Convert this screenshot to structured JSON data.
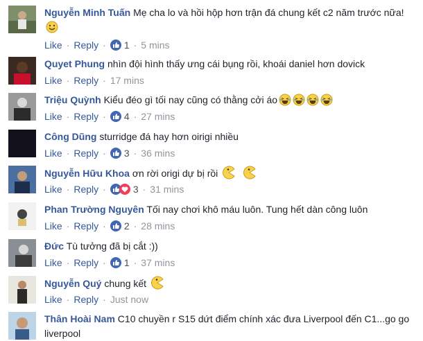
{
  "ui": {
    "like_label": "Like",
    "reply_label": "Reply",
    "separator": "·",
    "colors": {
      "name": "#365899",
      "meta": "#90949c",
      "like_badge": "#4267b2"
    }
  },
  "comments": [
    {
      "name": "Nguyễn Minh Tuấn",
      "text": "Mẹ cha lo và hồi hộp hơn trận đá chung kết c2 năm trước nữa!",
      "emoji": [
        "smile-icon"
      ],
      "reactions": [
        "like-icon"
      ],
      "count": "1",
      "time": "5 mins"
    },
    {
      "name": "Quyet Phung",
      "text": "nhìn đội hình thấy ưng cái bụng rồi, khoái daniel hơn dovick",
      "emoji": [],
      "reactions": [
        "like-icon"
      ],
      "count": "",
      "time": "17 mins"
    },
    {
      "name": "Triệu Quỳnh",
      "text": "Kiểu đéo gì tối nay cũng có thằng cởi áo",
      "emoji": [
        "laugh-icon",
        "laugh-icon",
        "laugh-icon",
        "laugh-icon"
      ],
      "reactions": [
        "like-icon"
      ],
      "count": "4",
      "time": "27 mins"
    },
    {
      "name": "Công Dũng",
      "text": "sturridge đá hay hơn oirigi nhiều",
      "emoji": [],
      "reactions": [
        "like-icon"
      ],
      "count": "3",
      "time": "36 mins"
    },
    {
      "name": "Nguyễn Hữu Khoa",
      "text": "ơn rời origi dự bị rồi",
      "emoji": [
        "pacman-icon",
        "pacman-icon"
      ],
      "reactions": [
        "like-icon",
        "love-icon"
      ],
      "count": "3",
      "time": "31 mins"
    },
    {
      "name": "Phan Trường Nguyên",
      "text": "Tối nay chơi khô máu luôn. Tung hết dàn công luôn",
      "emoji": [],
      "reactions": [
        "like-icon"
      ],
      "count": "2",
      "time": "28 mins"
    },
    {
      "name": "Đức",
      "text": "Tù tưởng đã bị cắt :))",
      "emoji": [],
      "reactions": [
        "like-icon"
      ],
      "count": "1",
      "time": "37 mins"
    },
    {
      "name": "Nguyễn Quý",
      "text": "chung kết",
      "emoji": [
        "pacman-icon"
      ],
      "reactions": [],
      "count": "",
      "time": "Just now"
    },
    {
      "name": "Thân Hoài Nam",
      "text": "C10 chuyền r S15 dứt điểm chính xác đưa Liverpool đến C1...go go liverpool",
      "emoji": [],
      "reactions": [],
      "count": "",
      "time": ""
    }
  ]
}
